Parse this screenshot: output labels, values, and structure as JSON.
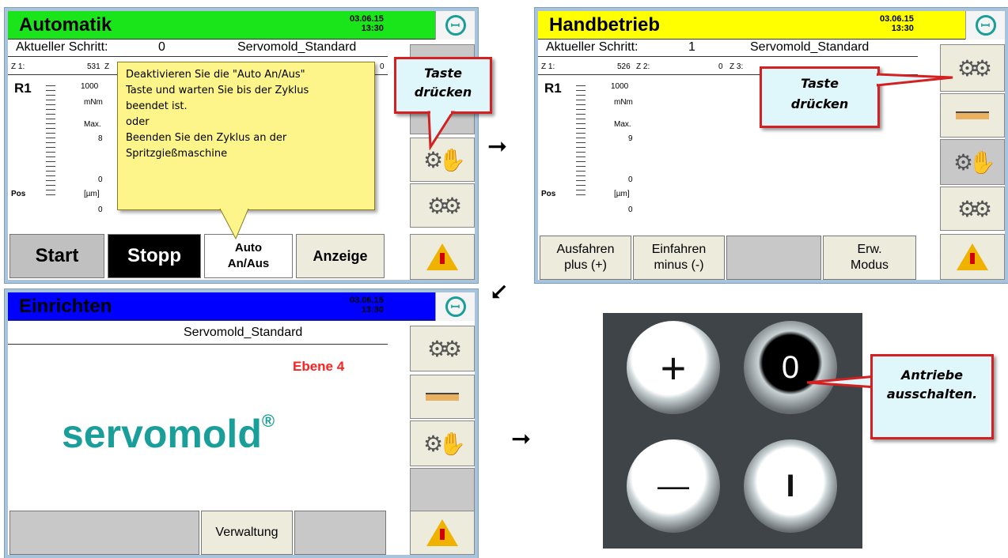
{
  "colors": {
    "automatik": "#1ae41a",
    "handbetrieb": "#ffff00",
    "einrichten": "#0000ff",
    "accent": "#1a9e9a",
    "callout_border": "#d42020"
  },
  "automatik": {
    "title": "Automatik",
    "date": "03.06.15",
    "time": "13:30",
    "step_label": "Aktueller Schritt:",
    "step_value": "0",
    "program": "Servomold_Standard",
    "z1_label": "Z 1:",
    "z1_value": "531",
    "z2_label": "Z",
    "z3_value": "0",
    "r_label": "R1",
    "scale_top": "1000",
    "unit_nm": "mNm",
    "max_label": "Max.",
    "max_value": "8",
    "scale_zero": "0",
    "pos_label": "Pos",
    "unit_um": "[µm]",
    "pos_value": "0",
    "tooltip": [
      "Deaktivieren Sie die \"Auto An/Aus\"",
      "Taste und warten Sie bis der Zyklus",
      "beendet ist.",
      "oder",
      "Beenden Sie den Zyklus an der",
      "Spritzgießmaschine"
    ],
    "buttons": {
      "start": "Start",
      "stopp": "Stopp",
      "auto_line1": "Auto",
      "auto_line2": "An/Aus",
      "anzeige": "Anzeige"
    },
    "callout": [
      "Taste",
      "drücken"
    ]
  },
  "handbetrieb": {
    "title": "Handbetrieb",
    "date": "03.06.15",
    "time": "13:30",
    "step_label": "Aktueller Schritt:",
    "step_value": "1",
    "program": "Servomold_Standard",
    "z1_label": "Z 1:",
    "z1_value": "526",
    "z2_label": "Z 2:",
    "z2_value": "0",
    "z3_label": "Z 3:",
    "r_label": "R1",
    "scale_top": "1000",
    "unit_nm": "mNm",
    "max_label": "Max.",
    "max_value": "9",
    "scale_zero": "0",
    "pos_label": "Pos",
    "unit_um": "[µm]",
    "pos_value": "0",
    "buttons": {
      "ausfahren_1": "Ausfahren",
      "ausfahren_2": "plus (+)",
      "einfahren_1": "Einfahren",
      "einfahren_2": "minus (-)",
      "erw_1": "Erw.",
      "erw_2": "Modus"
    },
    "callout": [
      "Taste",
      "drücken"
    ]
  },
  "einrichten": {
    "title": "Einrichten",
    "date": "03.06.15",
    "time": "13:30",
    "program": "Servomold_Standard",
    "level": "Ebene 4",
    "brand": "servomold",
    "reg": "®",
    "buttons": {
      "verwaltung": "Verwaltung"
    }
  },
  "photo": {
    "plus": "+",
    "zero": "0",
    "minus": "—",
    "one": "I",
    "callout": [
      "Antriebe",
      "ausschalten."
    ]
  }
}
